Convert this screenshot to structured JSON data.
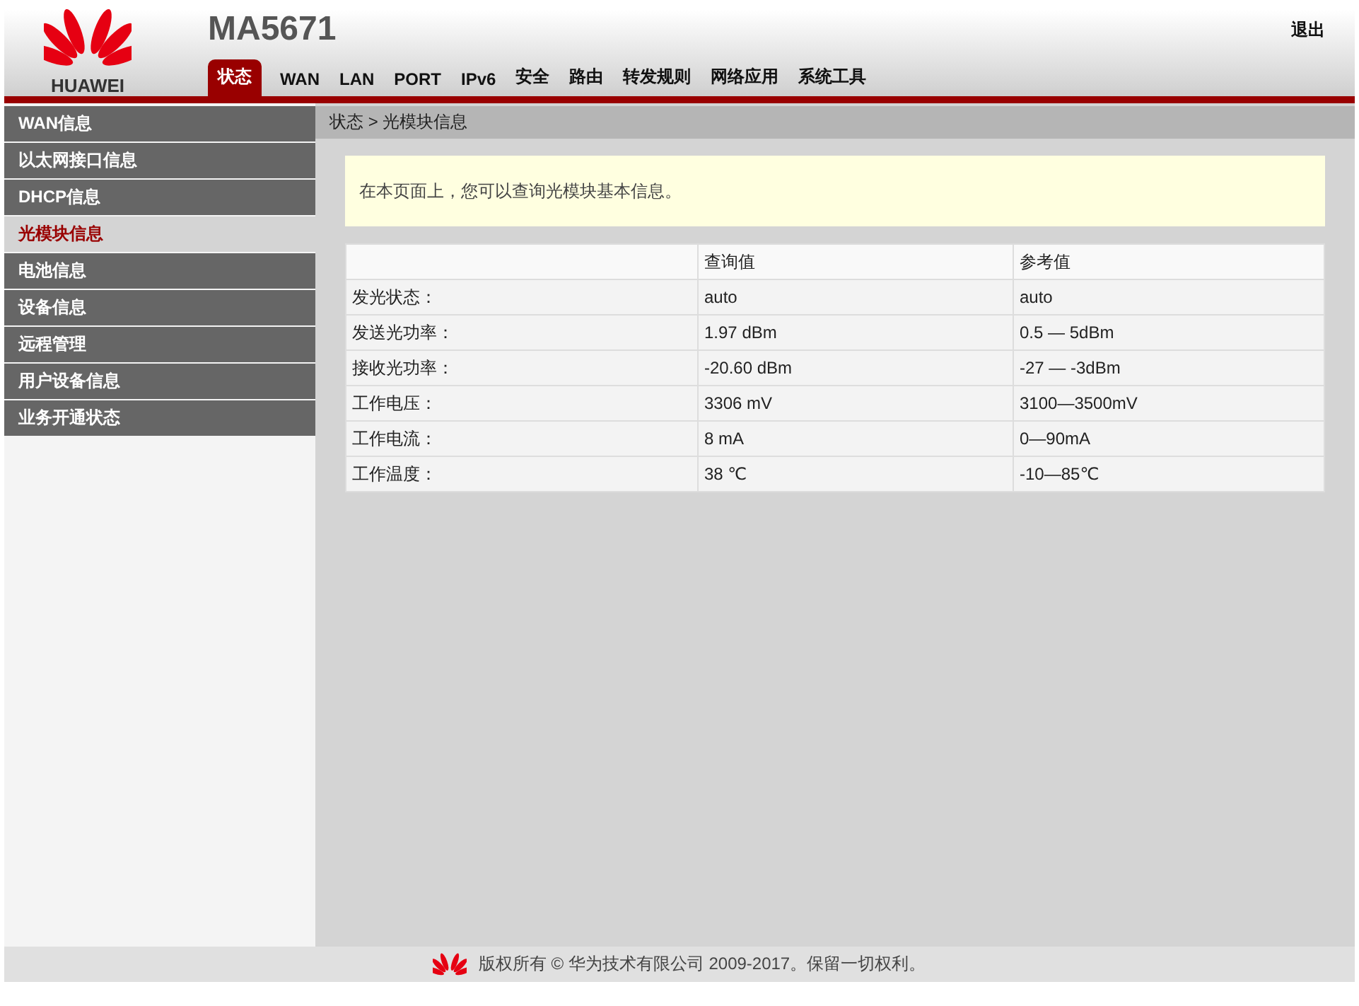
{
  "header": {
    "logo_text": "HUAWEI",
    "model": "MA5671",
    "logout": "退出"
  },
  "nav": [
    {
      "label": "状态",
      "selected": true
    },
    {
      "label": "WAN",
      "selected": false
    },
    {
      "label": "LAN",
      "selected": false
    },
    {
      "label": "PORT",
      "selected": false
    },
    {
      "label": "IPv6",
      "selected": false
    },
    {
      "label": "安全",
      "selected": false
    },
    {
      "label": "路由",
      "selected": false
    },
    {
      "label": "转发规则",
      "selected": false
    },
    {
      "label": "网络应用",
      "selected": false
    },
    {
      "label": "系统工具",
      "selected": false
    }
  ],
  "sidebar": {
    "items": [
      {
        "label": "WAN信息",
        "selected": false
      },
      {
        "label": "以太网接口信息",
        "selected": false
      },
      {
        "label": "DHCP信息",
        "selected": false
      },
      {
        "label": "光模块信息",
        "selected": true
      },
      {
        "label": "电池信息",
        "selected": false
      },
      {
        "label": "设备信息",
        "selected": false
      },
      {
        "label": "远程管理",
        "selected": false
      },
      {
        "label": "用户设备信息",
        "selected": false
      },
      {
        "label": "业务开通状态",
        "selected": false
      }
    ]
  },
  "breadcrumb": "状态 > 光模块信息",
  "notice": "在本页面上，您可以查询光模块基本信息。",
  "table": {
    "columns": [
      "",
      "查询值",
      "参考值"
    ],
    "rows": [
      [
        "发光状态：",
        "auto",
        "auto"
      ],
      [
        "发送光功率：",
        "1.97 dBm",
        "0.5 — 5dBm"
      ],
      [
        "接收光功率：",
        "-20.60 dBm",
        "-27 — -3dBm"
      ],
      [
        "工作电压：",
        "3306 mV",
        "3100—3500mV"
      ],
      [
        "工作电流：",
        "8 mA",
        "0—90mA"
      ],
      [
        "工作温度：",
        "38 ℃",
        "-10—85℃"
      ]
    ]
  },
  "footer": "版权所有 © 华为技术有限公司 2009-2017。保留一切权利。"
}
